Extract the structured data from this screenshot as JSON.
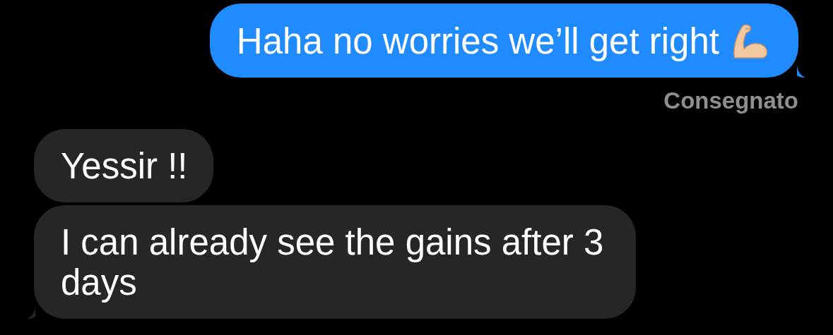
{
  "messages": [
    {
      "kind": "sent",
      "text": "Haha no worries we’ll get right",
      "tail": true
    },
    {
      "kind": "receipt",
      "text": "Consegnato"
    },
    {
      "kind": "received",
      "text": "Yessir !!",
      "tail": false
    },
    {
      "kind": "received",
      "text": "I can already see the gains after 3 days",
      "tail": true
    }
  ]
}
